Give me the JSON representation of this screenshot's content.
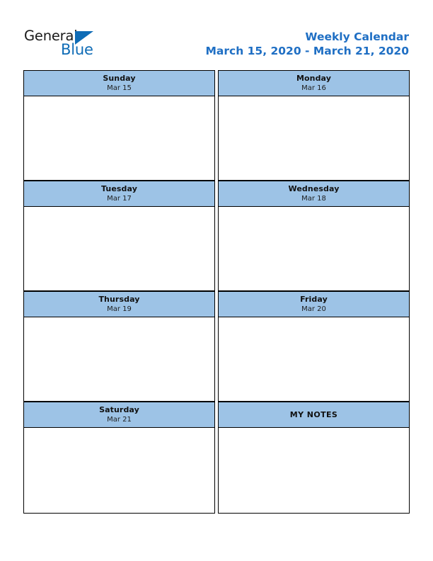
{
  "brand": {
    "name_part1": "General",
    "name_part2": "Blue",
    "logo_icon": "blue-triangle-icon",
    "accent_color": "#0f6cb6"
  },
  "header": {
    "title": "Weekly Calendar",
    "date_range": "March 15, 2020 - March 21, 2020",
    "title_color": "#1f6fc4"
  },
  "theme": {
    "header_cell_background": "#9dc3e6",
    "border_color": "#000000",
    "body_background": "#ffffff"
  },
  "calendar": {
    "rows": [
      {
        "cells": [
          {
            "type": "day",
            "day_name": "Sunday",
            "date_label": "Mar 15",
            "content": ""
          },
          {
            "type": "day",
            "day_name": "Monday",
            "date_label": "Mar 16",
            "content": ""
          }
        ]
      },
      {
        "cells": [
          {
            "type": "day",
            "day_name": "Tuesday",
            "date_label": "Mar 17",
            "content": ""
          },
          {
            "type": "day",
            "day_name": "Wednesday",
            "date_label": "Mar 18",
            "content": ""
          }
        ]
      },
      {
        "cells": [
          {
            "type": "day",
            "day_name": "Thursday",
            "date_label": "Mar 19",
            "content": ""
          },
          {
            "type": "day",
            "day_name": "Friday",
            "date_label": "Mar 20",
            "content": ""
          }
        ]
      },
      {
        "cells": [
          {
            "type": "day",
            "day_name": "Saturday",
            "date_label": "Mar 21",
            "content": ""
          },
          {
            "type": "notes",
            "day_name": "MY NOTES",
            "date_label": "",
            "content": ""
          }
        ]
      }
    ]
  }
}
